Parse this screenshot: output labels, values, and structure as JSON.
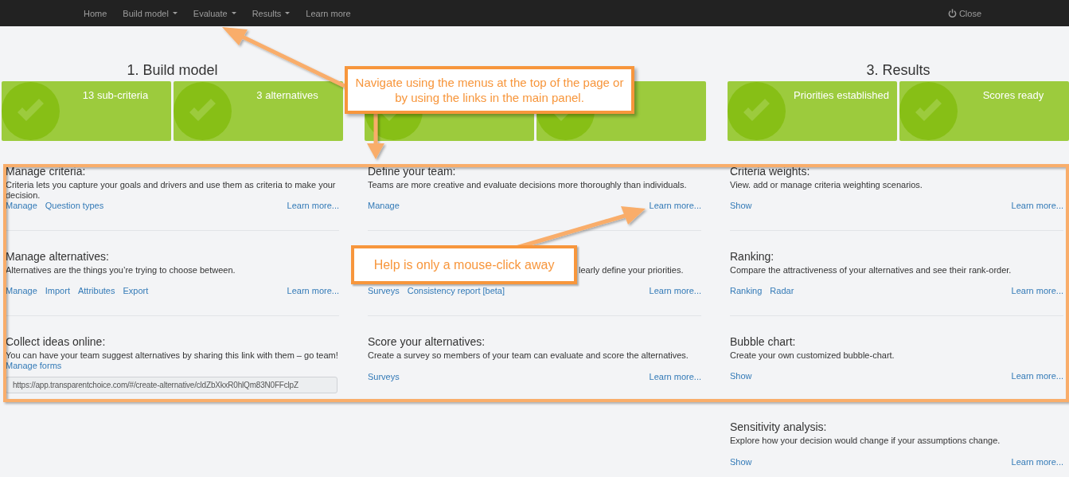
{
  "navbar": {
    "items": [
      {
        "label": "Home",
        "dropdown": false
      },
      {
        "label": "Build model",
        "dropdown": true
      },
      {
        "label": "Evaluate",
        "dropdown": true
      },
      {
        "label": "Results",
        "dropdown": true
      },
      {
        "label": "Learn more",
        "dropdown": false
      }
    ],
    "close": "Close"
  },
  "stages": [
    {
      "title": "1. Build model",
      "cards": [
        {
          "label": "13 sub-criteria",
          "done": true
        },
        {
          "label": "3 alternatives",
          "done": true
        }
      ]
    },
    {
      "cards": [
        {
          "done": true
        },
        {
          "done": true
        }
      ]
    },
    {
      "title": "3. Results",
      "cards": [
        {
          "label": "Priorities established",
          "done": true
        },
        {
          "label": "Scores ready",
          "done": true
        }
      ]
    }
  ],
  "columns": [
    [
      {
        "title": "Manage criteria:",
        "description": "Criteria lets you capture your goals and drivers and use them as criteria to make your decision.",
        "links": [
          "Manage",
          "Question types"
        ],
        "learn_more": "Learn more..."
      },
      {
        "title": "Manage alternatives:",
        "description": "Alternatives are the things you’re trying to choose between.",
        "links": [
          "Manage",
          "Import",
          "Attributes",
          "Export"
        ],
        "learn_more": "Learn more..."
      },
      {
        "title": "Collect ideas online:",
        "description": "You can have your team suggest alternatives by sharing this link with them – go team!",
        "links": [
          "Manage forms"
        ],
        "url": "https://app.transparentchoice.com/#/create-alternative/cldZbXkxR0hlQm83N0FFclpZ"
      }
    ],
    [
      {
        "title": "Define your team:",
        "description": "Teams are more creative and evaluate decisions more thoroughly than individuals.",
        "links": [
          "Manage"
        ],
        "learn_more": "Learn more..."
      },
      {
        "description": "learly define your priorities.",
        "links": [
          "Surveys",
          "Consistency report [beta]"
        ],
        "learn_more": "Learn more..."
      },
      {
        "title": "Score your alternatives:",
        "description": "Create a survey so members of your team can evaluate and score the alternatives.",
        "links": [
          "Surveys"
        ],
        "learn_more": "Learn more..."
      }
    ],
    [
      {
        "title": "Criteria weights:",
        "description": "View. add or manage criteria weighting scenarios.",
        "links": [
          "Show"
        ],
        "learn_more": "Learn more..."
      },
      {
        "title": "Ranking:",
        "description": "Compare the attractiveness of your alternatives and see their rank-order.",
        "links": [
          "Ranking",
          "Radar"
        ],
        "learn_more": "Learn more..."
      },
      {
        "title": "Bubble chart:",
        "description": "Create your own customized bubble-chart.",
        "links": [
          "Show"
        ],
        "learn_more": "Learn more..."
      },
      {
        "title": "Sensitivity analysis:",
        "description": "Explore how your decision would change if your assumptions change.",
        "links": [
          "Show"
        ],
        "learn_more": "Learn more..."
      }
    ]
  ],
  "annotations": [
    {
      "text": "Navigate using the menus at the top of the page or by using the links in the main panel."
    },
    {
      "text": "Help is only a mouse-click away"
    }
  ]
}
